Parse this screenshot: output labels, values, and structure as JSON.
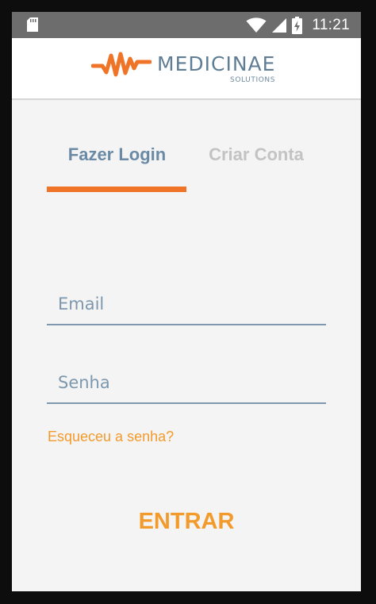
{
  "status_bar": {
    "time": "11:21",
    "icons": [
      "sd-card-icon",
      "wifi-icon",
      "cell-signal-icon",
      "battery-charging-icon"
    ]
  },
  "header": {
    "logo_name": "MEDICINAE",
    "logo_subtitle": "SOLUTIONS"
  },
  "tabs": [
    {
      "label": "Fazer Login",
      "active": true
    },
    {
      "label": "Criar Conta",
      "active": false
    }
  ],
  "form": {
    "email_placeholder": "Email",
    "email_value": "",
    "password_placeholder": "Senha",
    "password_value": "",
    "forgot_label": "Esqueceu a senha?",
    "submit_label": "ENTRAR"
  },
  "colors": {
    "accent_orange": "#f07428",
    "link_orange": "#f39a2c",
    "brand_blue": "#5f7e95",
    "tab_inactive": "#c3c3c3",
    "status_bar": "#6d6d6d",
    "background": "#f4f4f4"
  }
}
